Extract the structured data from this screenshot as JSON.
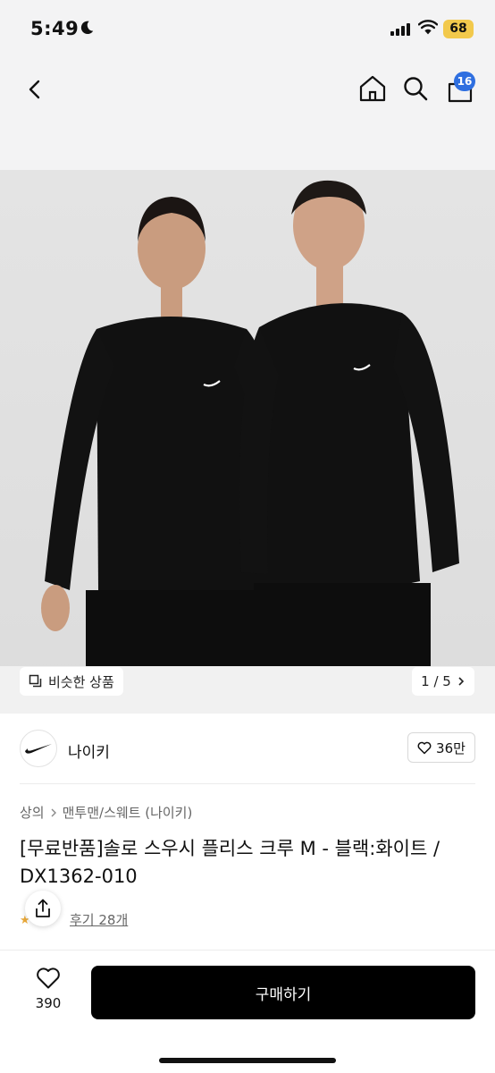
{
  "status_bar": {
    "time": "5:49",
    "battery": "68"
  },
  "nav": {
    "cart_count": "16"
  },
  "gallery": {
    "similar_label": "비슷한 상품",
    "page_indicator": "1 / 5"
  },
  "brand": {
    "name": "나이키",
    "likes": "36만"
  },
  "breadcrumb": {
    "category": "상의",
    "subcategory": "맨투맨/스웨트 (나이키)"
  },
  "product": {
    "title": "[무료반품]솔로 스우시 플리스 크루 M - 블랙:화이트 / DX1362-010",
    "review_link": "후기 28개"
  },
  "bottom_bar": {
    "wish_count": "390",
    "buy_label": "구매하기"
  },
  "colors": {
    "accent_badge": "#2f6fe0",
    "buy_button": "#000000",
    "battery": "#f2c94c"
  }
}
